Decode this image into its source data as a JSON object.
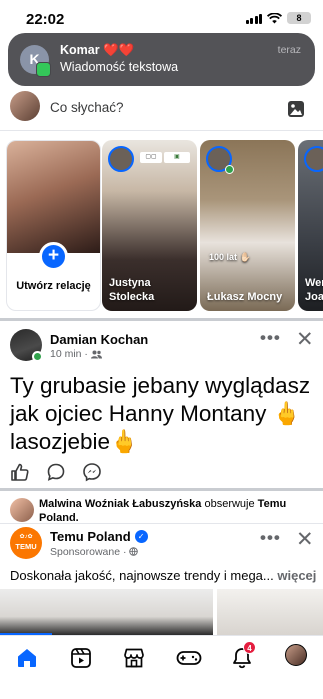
{
  "status_bar": {
    "time": "22:02",
    "battery": "8"
  },
  "notification": {
    "avatar_letter": "K",
    "title": "Komar ❤️❤️",
    "body": "Wiadomość tekstowa",
    "time": "teraz",
    "app_icon": "messages-icon"
  },
  "composer": {
    "placeholder": "Co słychać?"
  },
  "stories": [
    {
      "label": "Utwórz relację",
      "type": "create"
    },
    {
      "label": "Justyna Stolecka",
      "type": "story"
    },
    {
      "label": "Łukasz Mocny",
      "type": "story",
      "overlay_text": "100 lat ✋🏻"
    },
    {
      "label": "Wer Joa",
      "type": "story"
    }
  ],
  "post1": {
    "author": "Damian Kochan",
    "meta": "10 min ·",
    "audience_icon": "friends-icon",
    "text": "Ty grubasie jebany wyglądasz jak ojciec Hanny Montany 🖕 lasozjebie🖕",
    "actions": [
      "like-icon",
      "comment-icon",
      "messenger-icon"
    ]
  },
  "follow_notice": {
    "actor": "Malwina Woźniak Łabuszyńska",
    "verb": "obserwuje",
    "target": "Temu Poland."
  },
  "ad_post": {
    "logo_text": "TEMU",
    "author": "Temu Poland",
    "sponsored": "Sponsorowane ·",
    "text": "Doskonała jakość, najnowsze trendy i mega...",
    "more": "więcej"
  },
  "tabbar": {
    "tabs": [
      "home-icon",
      "video-icon",
      "marketplace-icon",
      "gaming-icon",
      "notifications-icon",
      "profile-avatar"
    ],
    "notifications_badge": "4"
  },
  "colors": {
    "accent": "#0866ff",
    "notif_badge": "#e41e3f",
    "online": "#31a24c",
    "temu": "#fb7701"
  }
}
